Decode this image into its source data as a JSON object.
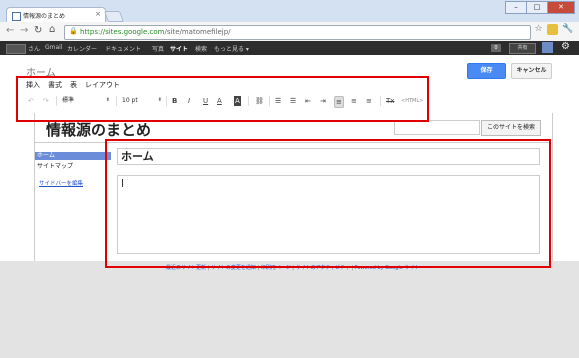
{
  "browser": {
    "tab_title": "情報源のまとめ",
    "tab_close": "×",
    "url_host": "https://sites.google.com",
    "url_path": "/site/matomefilejp/",
    "nav": {
      "back": "←",
      "forward": "→",
      "reload": "↻",
      "home": "⌂"
    },
    "window_controls": {
      "minimize": "–",
      "maximize": "□",
      "close": "✕"
    },
    "toolbar_icons": {
      "star": "☆",
      "wrench": "🔧"
    }
  },
  "google_bar": {
    "items": [
      "さん",
      "Gmail",
      "カレンダー",
      "ドキュメント",
      "写真",
      "サイト",
      "検索",
      "もっと見る ▾"
    ],
    "active_index": 5,
    "count": "0",
    "share_label": "共有",
    "gear": "⚙"
  },
  "editor": {
    "page_label": "ホーム",
    "save_label": "保存",
    "cancel_label": "キャンセル",
    "menu": [
      "挿入",
      "書式",
      "表",
      "レイアウト"
    ],
    "toolbar": {
      "undo": "↶",
      "redo": "↷",
      "style_dropdown": "標準",
      "size_dropdown": "10 pt",
      "bold": "B",
      "italic": "I",
      "underline": "U",
      "text_color": "A",
      "highlight": "A",
      "link": "⛓",
      "numbered_list": "☰",
      "bulleted_list": "☰",
      "outdent": "⇤",
      "indent": "⇥",
      "align_left": "≡",
      "align_center": "≡",
      "align_right": "≡",
      "clear_format": "Tx",
      "html": "<HTML>"
    }
  },
  "site": {
    "title": "情報源のまとめ",
    "search_button": "このサイトを検索",
    "sidebar": {
      "items": [
        "ホーム",
        "サイトマップ"
      ],
      "edit_link": "サイドバーを編集"
    },
    "page_title_value": "ホーム",
    "footer": [
      "最近のサイト更新",
      "サイトの変更を通知",
      "印刷用ページ",
      "サイトのアクティビティ",
      "Powered by Google サイト"
    ]
  },
  "colors": {
    "accent_blue": "#4a8af4",
    "highlight_red": "#e00000",
    "sidebar_selected": "#6b8cd8"
  }
}
